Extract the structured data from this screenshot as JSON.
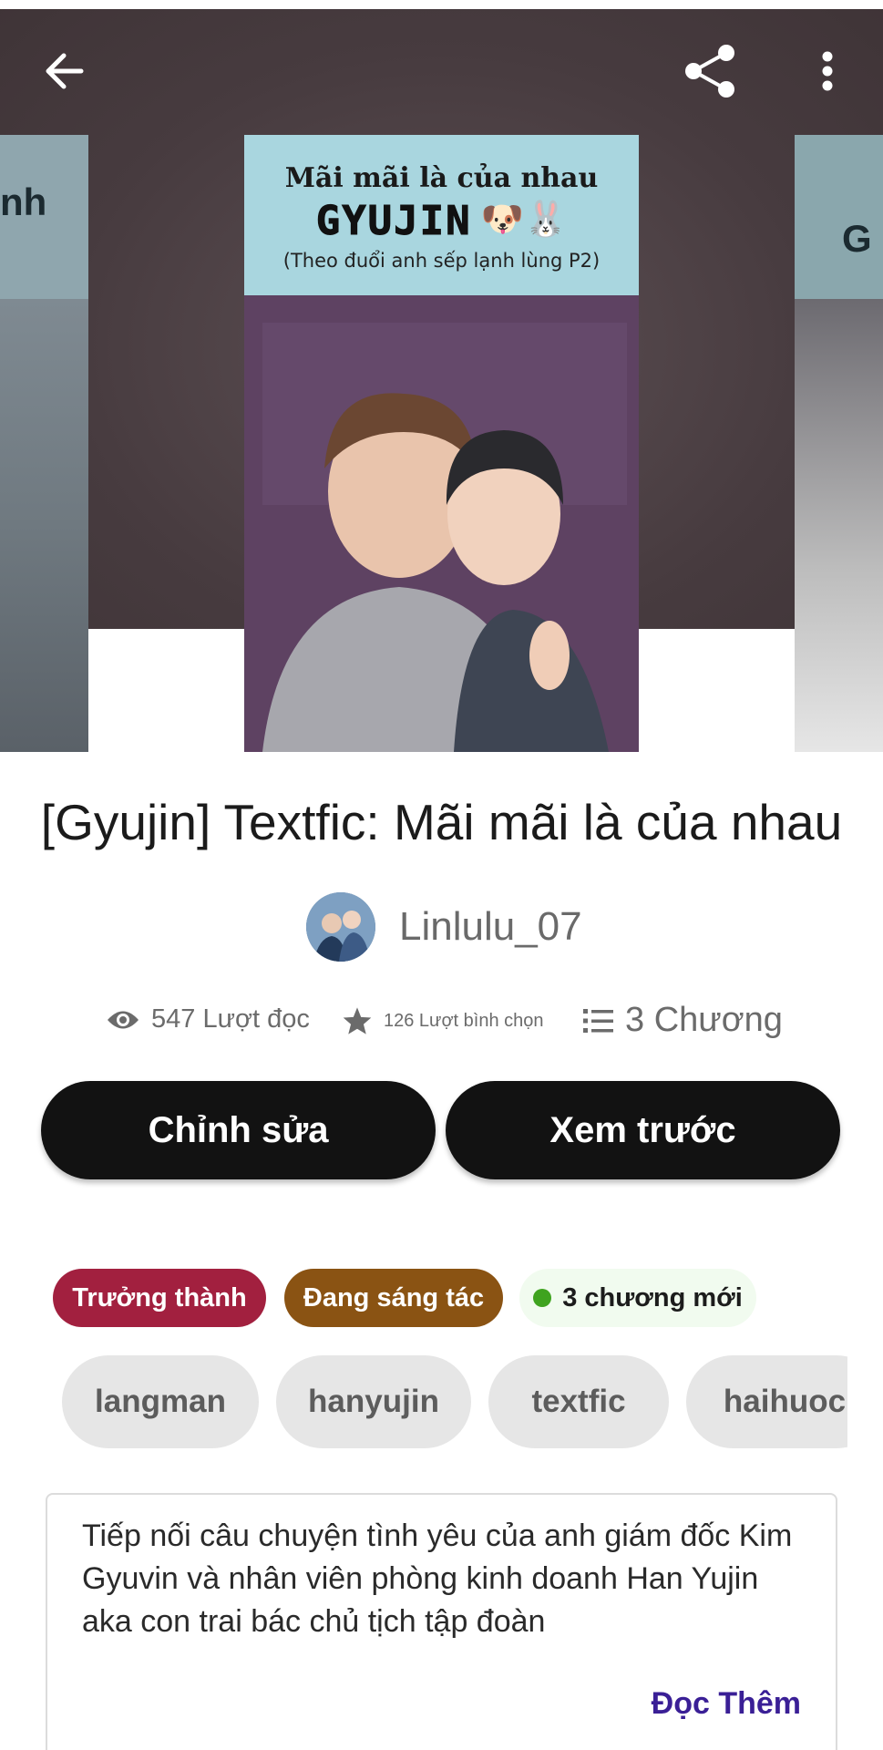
{
  "header": {
    "back_icon": "arrow-left-icon",
    "share_icon": "share-icon",
    "more_icon": "more-vertical-icon"
  },
  "covers": {
    "main": {
      "title_line": "Mãi mãi là của nhau",
      "brand": "GYUJIN",
      "subtitle": "(Theo đuổi anh sếp lạnh lùng P2)",
      "emoji": "🐶🐰"
    },
    "left_fragment": "nh",
    "right_fragment": "G"
  },
  "story": {
    "title": "[Gyujin] Textfic: Mãi mãi là của nhau",
    "author": "Linlulu_07"
  },
  "stats": {
    "reads": "547 Lượt đọc",
    "votes": "126 Lượt bình chọn",
    "parts": "3 Chương"
  },
  "actions": {
    "edit": "Chỉnh sửa",
    "preview": "Xem trước"
  },
  "badges": {
    "mature": "Trưởng thành",
    "ongoing": "Đang sáng tác",
    "new_parts": "3 chương mới"
  },
  "tags": [
    "langman",
    "hanyujin",
    "textfic",
    "haihuoc"
  ],
  "description": {
    "text": "Tiếp nối câu chuyện tình yêu của anh giám đốc Kim Gyuvin và nhân viên phòng kinh doanh Han Yujin aka con trai bác chủ tịch tập đoàn",
    "read_more": "Đọc Thêm"
  },
  "colors": {
    "mature": "#a2203f",
    "ongoing": "#8a5313",
    "new_dot": "#3fa31f",
    "read_more": "#3a1f96",
    "button_bg": "#121212"
  }
}
